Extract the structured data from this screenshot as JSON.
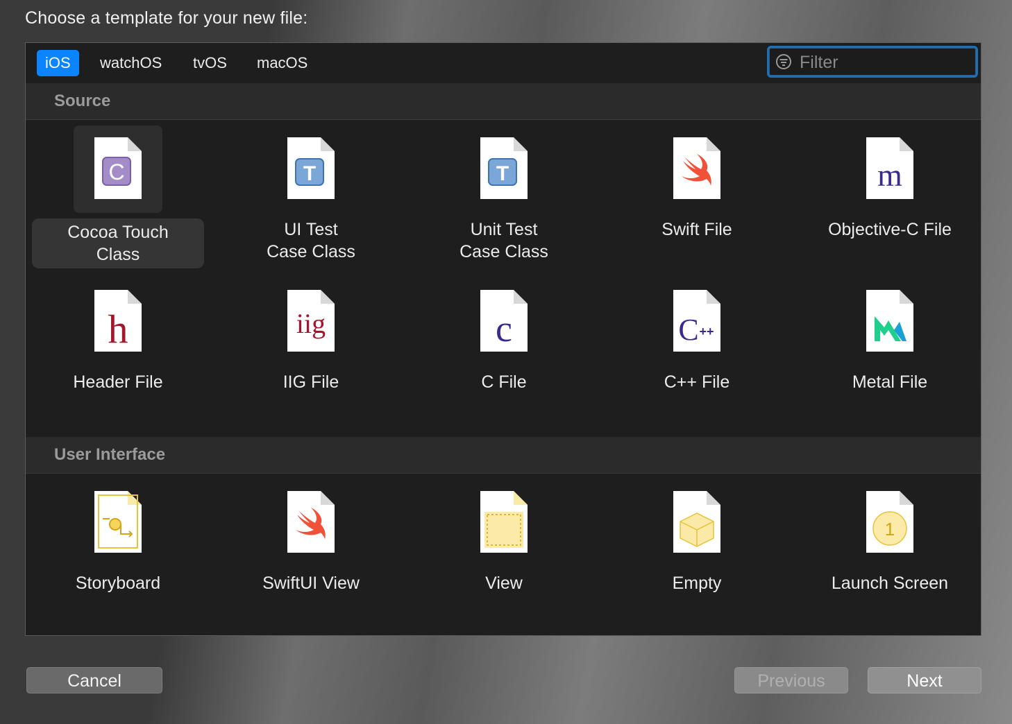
{
  "prompt": "Choose a template for your new file:",
  "tabs": [
    {
      "label": "iOS",
      "active": true
    },
    {
      "label": "watchOS",
      "active": false
    },
    {
      "label": "tvOS",
      "active": false
    },
    {
      "label": "macOS",
      "active": false
    }
  ],
  "filter": {
    "placeholder": "Filter",
    "value": ""
  },
  "sections": [
    {
      "title": "Source",
      "items": [
        {
          "label": "Cocoa Touch\nClass",
          "icon": "cocoa-touch-class-icon",
          "selected": true
        },
        {
          "label": "UI Test\nCase Class",
          "icon": "ui-test-case-class-icon"
        },
        {
          "label": "Unit Test\nCase Class",
          "icon": "unit-test-case-class-icon"
        },
        {
          "label": "Swift File",
          "icon": "swift-file-icon"
        },
        {
          "label": "Objective-C File",
          "icon": "objective-c-file-icon"
        },
        {
          "label": "Header File",
          "icon": "header-file-icon"
        },
        {
          "label": "IIG File",
          "icon": "iig-file-icon"
        },
        {
          "label": "C File",
          "icon": "c-file-icon"
        },
        {
          "label": "C++ File",
          "icon": "cpp-file-icon"
        },
        {
          "label": "Metal File",
          "icon": "metal-file-icon"
        }
      ]
    },
    {
      "title": "User Interface",
      "items": [
        {
          "label": "Storyboard",
          "icon": "storyboard-icon"
        },
        {
          "label": "SwiftUI View",
          "icon": "swiftui-view-icon"
        },
        {
          "label": "View",
          "icon": "view-icon"
        },
        {
          "label": "Empty",
          "icon": "empty-icon"
        },
        {
          "label": "Launch Screen",
          "icon": "launch-screen-icon"
        }
      ]
    }
  ],
  "buttons": {
    "cancel": "Cancel",
    "previous": "Previous",
    "next": "Next"
  },
  "colors": {
    "accent": "#0a84ff",
    "focus_ring": "#1f6fb5",
    "panel": "#1e1e1e",
    "section_header": "#2b2b2b"
  }
}
